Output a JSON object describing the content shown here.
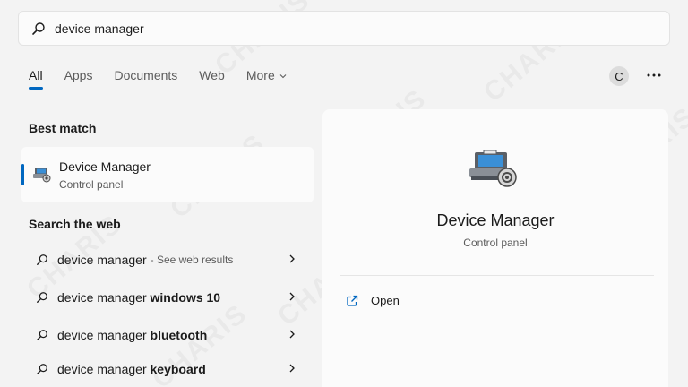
{
  "search": {
    "value": "device manager"
  },
  "tabs": [
    {
      "label": "All",
      "active": true
    },
    {
      "label": "Apps"
    },
    {
      "label": "Documents"
    },
    {
      "label": "Web"
    },
    {
      "label": "More"
    }
  ],
  "account": {
    "initial": "C"
  },
  "best_match": {
    "heading": "Best match",
    "title": "Device Manager",
    "subtitle": "Control panel"
  },
  "web": {
    "heading": "Search the web",
    "results": [
      {
        "prefix": "device manager",
        "bold": "",
        "hint": "- See web results"
      },
      {
        "prefix": "device manager ",
        "bold": "windows 10",
        "hint": ""
      },
      {
        "prefix": "device manager ",
        "bold": "bluetooth",
        "hint": ""
      },
      {
        "prefix": "device manager ",
        "bold": "keyboard",
        "hint": ""
      }
    ]
  },
  "detail": {
    "title": "Device Manager",
    "subtitle": "Control panel",
    "actions": [
      {
        "label": "Open",
        "icon": "open-external-icon"
      }
    ]
  },
  "watermark": "CHARIS",
  "colors": {
    "accent": "#0067c0",
    "background": "#f3f3f3",
    "card": "#fbfbfb"
  }
}
